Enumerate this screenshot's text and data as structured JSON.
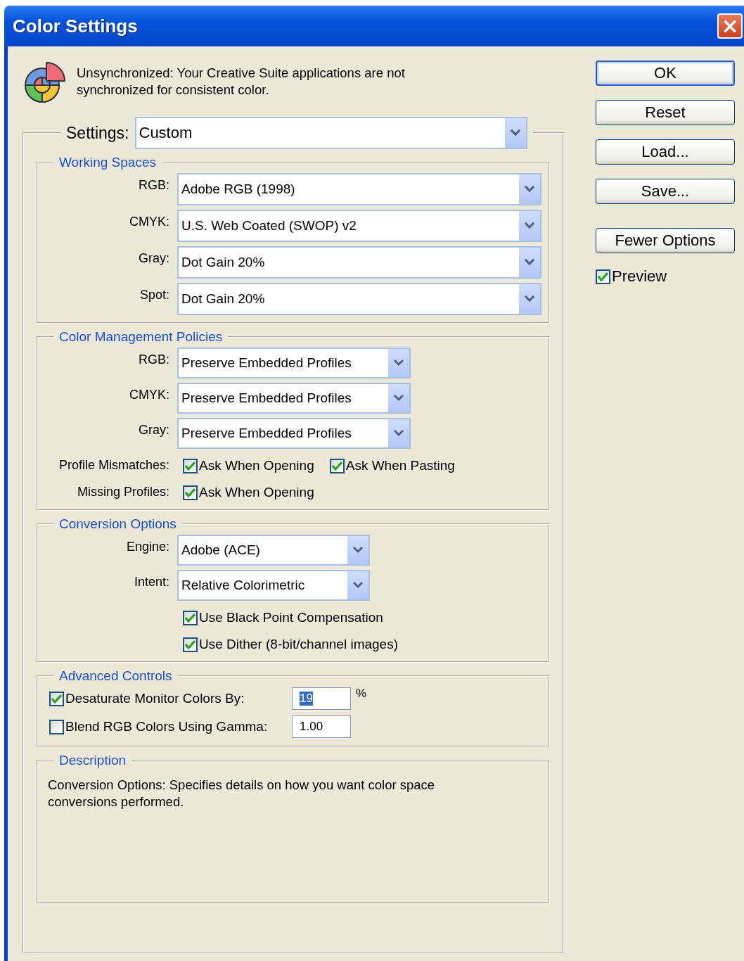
{
  "window": {
    "title": "Color Settings",
    "close": "×"
  },
  "message": "Unsynchronized: Your Creative Suite applications are not synchronized for consistent color.",
  "settings": {
    "label": "Settings:",
    "value": "Custom"
  },
  "groups": [
    {
      "title": "Working Spaces",
      "rows": [
        {
          "kind": "select",
          "label": "RGB:",
          "value": "Adobe RGB (1998)"
        },
        {
          "kind": "select",
          "label": "CMYK:",
          "value": "U.S. Web Coated (SWOP) v2"
        },
        {
          "kind": "select",
          "label": "Gray:",
          "value": "Dot Gain 20%"
        },
        {
          "kind": "select",
          "label": "Spot:",
          "value": "Dot Gain 20%"
        }
      ]
    },
    {
      "title": "Color Management Policies",
      "rows": [
        {
          "kind": "select",
          "label": "RGB:",
          "value": "Preserve Embedded Profiles"
        },
        {
          "kind": "select",
          "label": "CMYK:",
          "value": "Preserve Embedded Profiles"
        },
        {
          "kind": "select",
          "label": "Gray:",
          "value": "Preserve Embedded Profiles"
        },
        {
          "kind": "checks",
          "label": "Profile Mismatches:",
          "checks": [
            {
              "label": "Ask When Opening",
              "checked": true
            },
            {
              "label": "Ask When Pasting",
              "checked": true
            }
          ]
        },
        {
          "kind": "checks",
          "label": "Missing Profiles:",
          "checks": [
            {
              "label": "Ask When Opening",
              "checked": true
            }
          ]
        }
      ]
    },
    {
      "title": "Conversion Options",
      "rows": [
        {
          "kind": "select",
          "label": "Engine:",
          "value": "Adobe (ACE)"
        },
        {
          "kind": "select",
          "label": "Intent:",
          "value": "Relative Colorimetric"
        },
        {
          "kind": "checks",
          "checks": [
            {
              "label": "Use Black Point Compensation",
              "checked": true
            }
          ]
        },
        {
          "kind": "checks",
          "checks": [
            {
              "label": "Use Dither (8-bit/channel images)",
              "checked": true
            }
          ]
        }
      ]
    },
    {
      "title": "Advanced Controls",
      "rows": [
        {
          "kind": "entry",
          "label": "Desaturate Monitor Colors By:",
          "checked": true,
          "value": "19",
          "selected": true,
          "suffix": "%"
        },
        {
          "kind": "entry",
          "label": "Blend RGB Colors Using Gamma:",
          "checked": false,
          "value": "1.00",
          "selected": false
        }
      ]
    },
    {
      "title": "Description",
      "rows": [
        {
          "kind": "text",
          "text": "Conversion Options:  Specifies details on how you want color space conversions performed."
        }
      ]
    }
  ],
  "buttons": [
    {
      "label": "OK",
      "default": true
    },
    {
      "label": "Reset",
      "default": false
    },
    {
      "label": "Load...",
      "default": false
    },
    {
      "label": "Save...",
      "default": false
    },
    {
      "label": "Fewer Options",
      "default": false
    }
  ],
  "preview": {
    "label": "Preview",
    "checked": true
  }
}
